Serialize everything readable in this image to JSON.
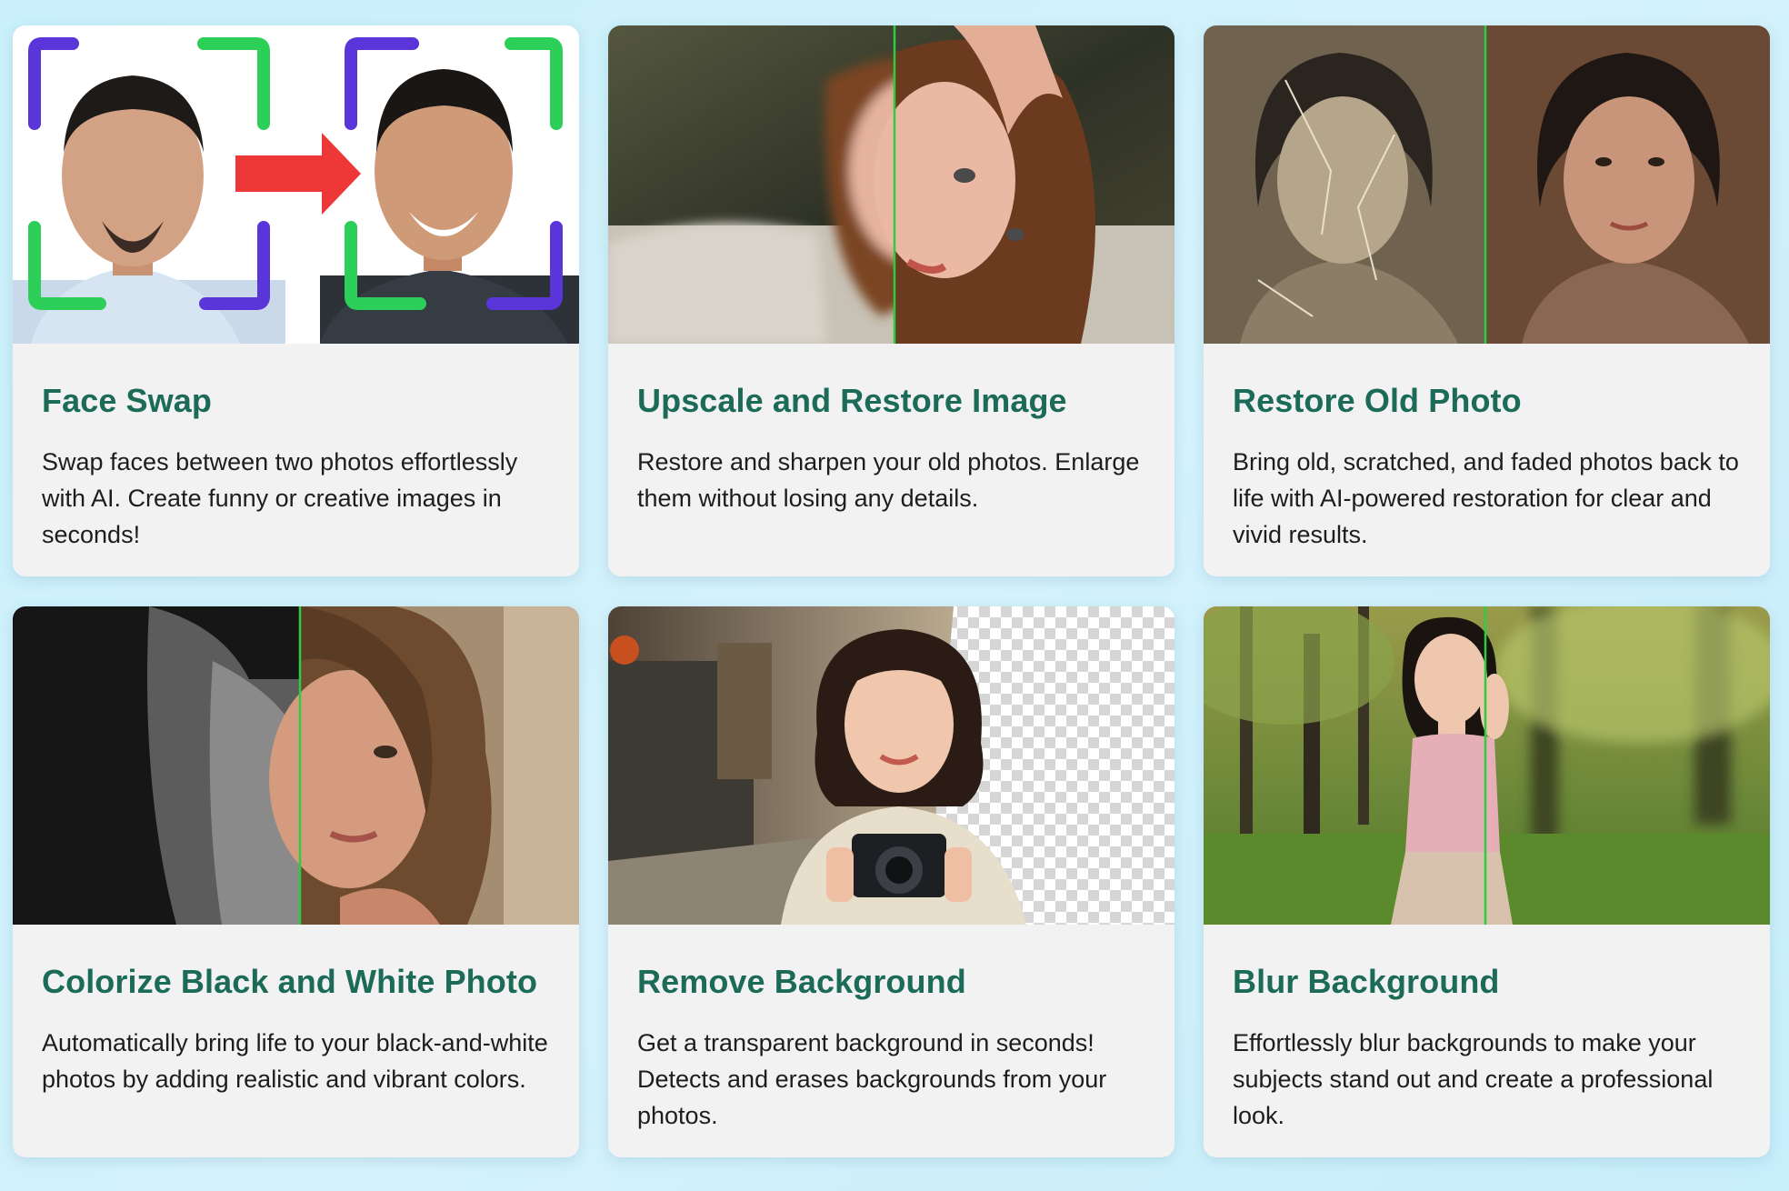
{
  "colors": {
    "title": "#1c6b58",
    "divider": "#2ecc40",
    "background": "#cdf1fb"
  },
  "cards": [
    {
      "title": "Face Swap",
      "description": "Swap faces between two photos effortlessly with AI. Create funny or creative images in seconds!",
      "thumbnail_icon": "face-swap-arrow-icon"
    },
    {
      "title": "Upscale and Restore Image",
      "description": "Restore and sharpen your old photos. Enlarge them without losing any details.",
      "thumbnail_icon": "before-after-slider-icon"
    },
    {
      "title": "Restore Old Photo",
      "description": "Bring old, scratched, and faded photos back to life with AI-powered restoration for clear and vivid results.",
      "thumbnail_icon": "before-after-slider-icon"
    },
    {
      "title": "Colorize Black and White Photo",
      "description": "Automatically bring life to your black-and-white photos by adding realistic and vibrant colors.",
      "thumbnail_icon": "before-after-slider-icon"
    },
    {
      "title": "Remove Background",
      "description": "Get a transparent background in seconds! Detects and erases backgrounds from your photos.",
      "thumbnail_icon": "transparency-checker-icon"
    },
    {
      "title": "Blur Background",
      "description": "Effortlessly blur backgrounds to make your subjects stand out and create a professional look.",
      "thumbnail_icon": "before-after-slider-icon"
    }
  ]
}
